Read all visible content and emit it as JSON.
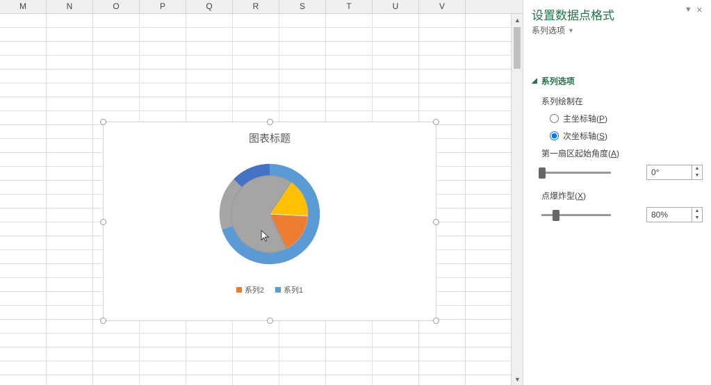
{
  "columns": [
    "M",
    "N",
    "O",
    "P",
    "Q",
    "R",
    "S",
    "T",
    "U",
    "V"
  ],
  "chart": {
    "title": "图表标题",
    "legend": [
      {
        "label": "系列2",
        "color": "#ed7d31"
      },
      {
        "label": "系列1",
        "color": "#5b9bd5"
      }
    ]
  },
  "chart_data": {
    "type": "pie",
    "title": "图表标题",
    "series": [
      {
        "name": "系列1",
        "values": [
          55,
          25,
          20
        ],
        "colors": [
          "#5b9bd5",
          "#4472c4",
          "#a5a5a5"
        ]
      },
      {
        "name": "系列2",
        "values": [
          18,
          22,
          60
        ],
        "colors": [
          "#ffc000",
          "#ed7d31",
          "#a5a5a5"
        ]
      }
    ]
  },
  "panel": {
    "title": "设置数据点格式",
    "subtitle": "系列选项",
    "section": "系列选项",
    "plot_on_label": "系列绘制在",
    "primary_axis_label": "主坐标轴(P)",
    "secondary_axis_label": "次坐标轴(S)",
    "axis_selected": "secondary",
    "start_angle_label": "第一扇区起始角度(A)",
    "start_angle_value": "0°",
    "explosion_label": "点爆炸型(X)",
    "explosion_value": "80%"
  }
}
